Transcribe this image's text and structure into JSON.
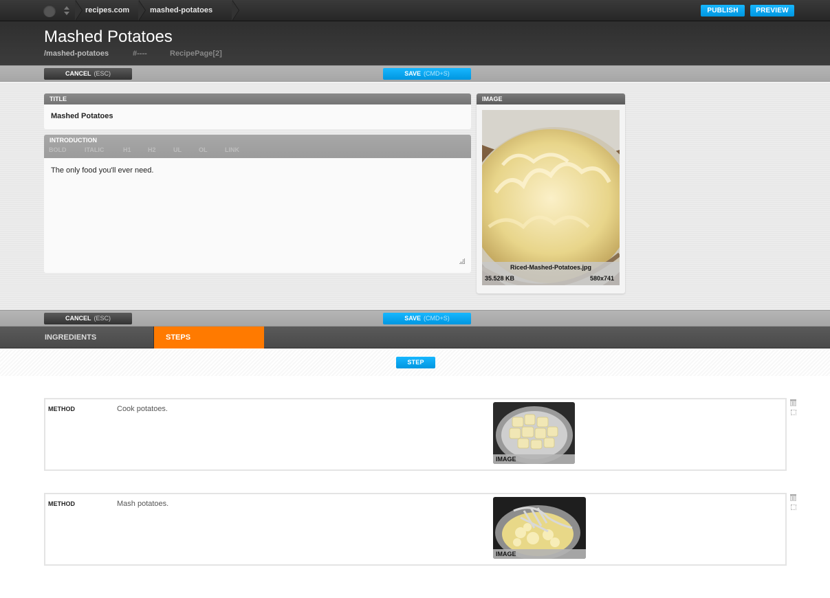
{
  "topbar": {
    "breadcrumbs": [
      "recipes.com",
      "mashed-potatoes"
    ],
    "publish_label": "PUBLISH",
    "preview_label": "PREVIEW"
  },
  "header": {
    "title": "Mashed Potatoes",
    "path": "/mashed-potatoes",
    "hash": "#----",
    "type": "RecipePage[2]"
  },
  "actions": {
    "cancel_label": "CANCEL",
    "cancel_hint": "(ESC)",
    "save_label": "SAVE",
    "save_hint": "(CMD+S)"
  },
  "form": {
    "title_label": "TITLE",
    "title_value": "Mashed Potatoes",
    "intro_label": "INTRODUCTION",
    "toolbar": [
      "BOLD",
      "ITALIC",
      "H1",
      "H2",
      "UL",
      "OL",
      "LINK"
    ],
    "intro_value": "The only food you'll ever need.",
    "image_label": "IMAGE",
    "image": {
      "filename": "Riced-Mashed-Potatoes.jpg",
      "size": "35.528 KB",
      "dimensions": "580x741"
    }
  },
  "tabs": [
    {
      "label": "INGREDIENTS",
      "active": false
    },
    {
      "label": "STEPS",
      "active": true
    }
  ],
  "add_step_label": "STEP",
  "steps": [
    {
      "label": "METHOD",
      "text": "Cook potatoes.",
      "image_label": "IMAGE"
    },
    {
      "label": "METHOD",
      "text": "Mash potatoes.",
      "image_label": "IMAGE"
    }
  ],
  "colors": {
    "accent_blue": "#0aa8f5",
    "active_tab": "#ff7a00"
  }
}
